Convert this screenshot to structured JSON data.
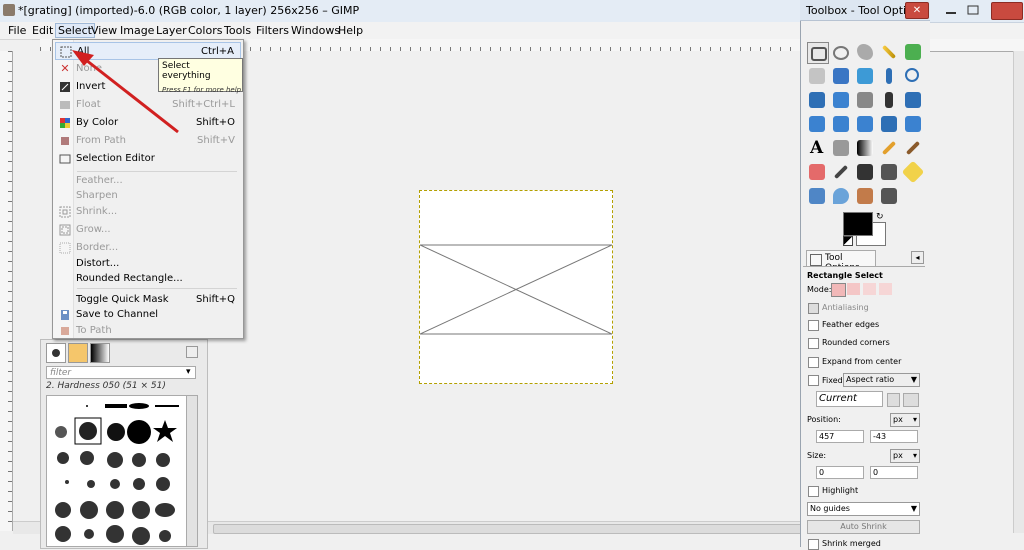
{
  "main_window": {
    "title": "*[grating] (imported)-6.0 (RGB color, 1 layer) 256x256 – GIMP"
  },
  "menubar": {
    "items": [
      "File",
      "Edit",
      "Select",
      "View",
      "Image",
      "Layer",
      "Colors",
      "Tools",
      "Filters",
      "Windows",
      "Help"
    ],
    "active": "Select"
  },
  "select_menu": {
    "items": [
      {
        "label": "All",
        "shortcut": "Ctrl+A",
        "icon": "select-all-icon",
        "enabled": true
      },
      {
        "label": "None",
        "shortcut": "",
        "icon": "select-none-icon",
        "enabled": false
      },
      {
        "label": "Invert",
        "shortcut": "",
        "icon": "invert-icon",
        "enabled": true
      },
      {
        "label": "Float",
        "shortcut": "Shift+Ctrl+L",
        "icon": "float-icon",
        "enabled": false
      },
      {
        "label": "By Color",
        "shortcut": "Shift+O",
        "icon": "by-color-icon",
        "enabled": true
      },
      {
        "label": "From Path",
        "shortcut": "Shift+V",
        "icon": "from-path-icon",
        "enabled": false
      },
      {
        "label": "Selection Editor",
        "shortcut": "",
        "icon": "selection-editor-icon",
        "enabled": true
      },
      {
        "label": "Feather...",
        "shortcut": "",
        "icon": "",
        "enabled": false
      },
      {
        "label": "Sharpen",
        "shortcut": "",
        "icon": "",
        "enabled": false
      },
      {
        "label": "Shrink...",
        "shortcut": "",
        "icon": "shrink-icon",
        "enabled": false
      },
      {
        "label": "Grow...",
        "shortcut": "",
        "icon": "grow-icon",
        "enabled": false
      },
      {
        "label": "Border...",
        "shortcut": "",
        "icon": "border-icon",
        "enabled": false
      },
      {
        "label": "Distort...",
        "shortcut": "",
        "icon": "",
        "enabled": true
      },
      {
        "label": "Rounded Rectangle...",
        "shortcut": "",
        "icon": "",
        "enabled": true
      },
      {
        "label": "Toggle Quick Mask",
        "shortcut": "Shift+Q",
        "icon": "",
        "enabled": true
      },
      {
        "label": "Save to Channel",
        "shortcut": "",
        "icon": "save-channel-icon",
        "enabled": true
      },
      {
        "label": "To Path",
        "shortcut": "",
        "icon": "to-path-icon",
        "enabled": false
      }
    ]
  },
  "tooltip": {
    "title": "Select everything",
    "hint": "Press F1 for more help"
  },
  "brushes_panel": {
    "filter_placeholder": "filter",
    "brush_name": "2. Hardness 050 (51 × 51)"
  },
  "toolbox": {
    "title": "Toolbox - Tool Options",
    "close_label": "✕"
  },
  "tool_options": {
    "tab_label": "Tool Options",
    "tool_name": "Rectangle Select",
    "mode_label": "Mode:",
    "antialiasing": "Antialiasing",
    "feather_edges": "Feather edges",
    "rounded_corners": "Rounded corners",
    "expand_from_center": "Expand from center",
    "fixed_label": "Fixed:",
    "fixed_value": "Aspect ratio",
    "current_value": "Current",
    "position_label": "Position:",
    "position_unit": "px",
    "position_x": "457",
    "position_y": "-43",
    "size_label": "Size:",
    "size_unit": "px",
    "size_w": "0",
    "size_h": "0",
    "highlight": "Highlight",
    "guides_value": "No guides",
    "auto_shrink": "Auto Shrink",
    "shrink_merged": "Shrink merged"
  },
  "colors": {
    "menu_highlight": "#e6eef9",
    "arrow": "#d12020",
    "selection_border": "#b3a000"
  }
}
